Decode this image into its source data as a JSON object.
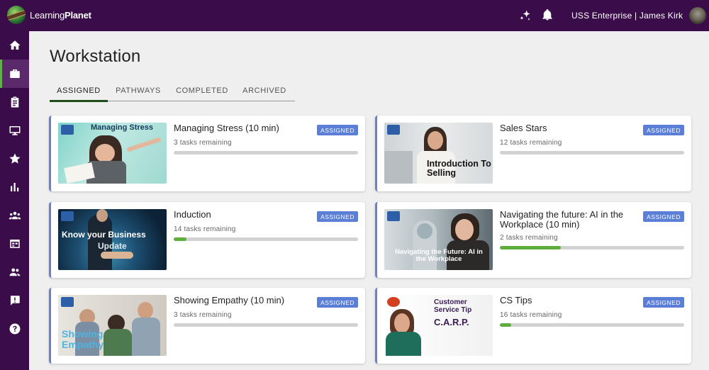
{
  "header": {
    "brand_light": "Learning",
    "brand_bold": "Planet",
    "account": "USS Enterprise | James Kirk",
    "icons": [
      "sparkle-icon",
      "bell-icon"
    ]
  },
  "sidebar": {
    "items": [
      {
        "name": "home-icon",
        "active": false
      },
      {
        "name": "briefcase-icon",
        "active": true
      },
      {
        "name": "clipboard-icon",
        "active": false
      },
      {
        "name": "monitor-icon",
        "active": false
      },
      {
        "name": "star-icon",
        "active": false
      },
      {
        "name": "bar-chart-icon",
        "active": false
      },
      {
        "name": "groups-icon",
        "active": false
      },
      {
        "name": "calendar-icon",
        "active": false
      },
      {
        "name": "people-icon",
        "active": false
      },
      {
        "name": "feedback-icon",
        "active": false
      },
      {
        "name": "help-icon",
        "active": false
      }
    ]
  },
  "page": {
    "title": "Workstation"
  },
  "tabs": [
    {
      "label": "ASSIGNED",
      "active": true
    },
    {
      "label": "PATHWAYS",
      "active": false
    },
    {
      "label": "COMPLETED",
      "active": false
    },
    {
      "label": "ARCHIVED",
      "active": false
    }
  ],
  "cards": [
    {
      "title": "Managing Stress (10 min)",
      "tasks": "3 tasks remaining",
      "progress": 0,
      "badge": "ASSIGNED",
      "thumb_text": "Managing Stress"
    },
    {
      "title": "Sales Stars",
      "tasks": "12 tasks remaining",
      "progress": 0,
      "badge": "ASSIGNED",
      "thumb_text": "Introduction To Selling"
    },
    {
      "title": "Induction",
      "tasks": "14 tasks remaining",
      "progress": 0.07,
      "badge": "ASSIGNED",
      "thumb_text": "Know your Business",
      "thumb_text2": "Update"
    },
    {
      "title": "Navigating the future: AI in the Workplace (10 min)",
      "tasks": "2 tasks remaining",
      "progress": 0.33,
      "badge": "ASSIGNED",
      "thumb_text": "Navigating the Future: AI in the Workplace"
    },
    {
      "title": "Showing Empathy (10 min)",
      "tasks": "3 tasks remaining",
      "progress": 0,
      "badge": "ASSIGNED",
      "thumb_text": "Showing Empathy"
    },
    {
      "title": "CS Tips",
      "tasks": "16 tasks remaining",
      "progress": 0.06,
      "badge": "ASSIGNED",
      "thumb_text": "Customer Service Tip",
      "thumb_text2": "C.A.R.P."
    }
  ],
  "colors": {
    "topbar": "#3a0d4a",
    "accent_green": "#5fad3d",
    "badge_blue": "#5b7fd6"
  }
}
